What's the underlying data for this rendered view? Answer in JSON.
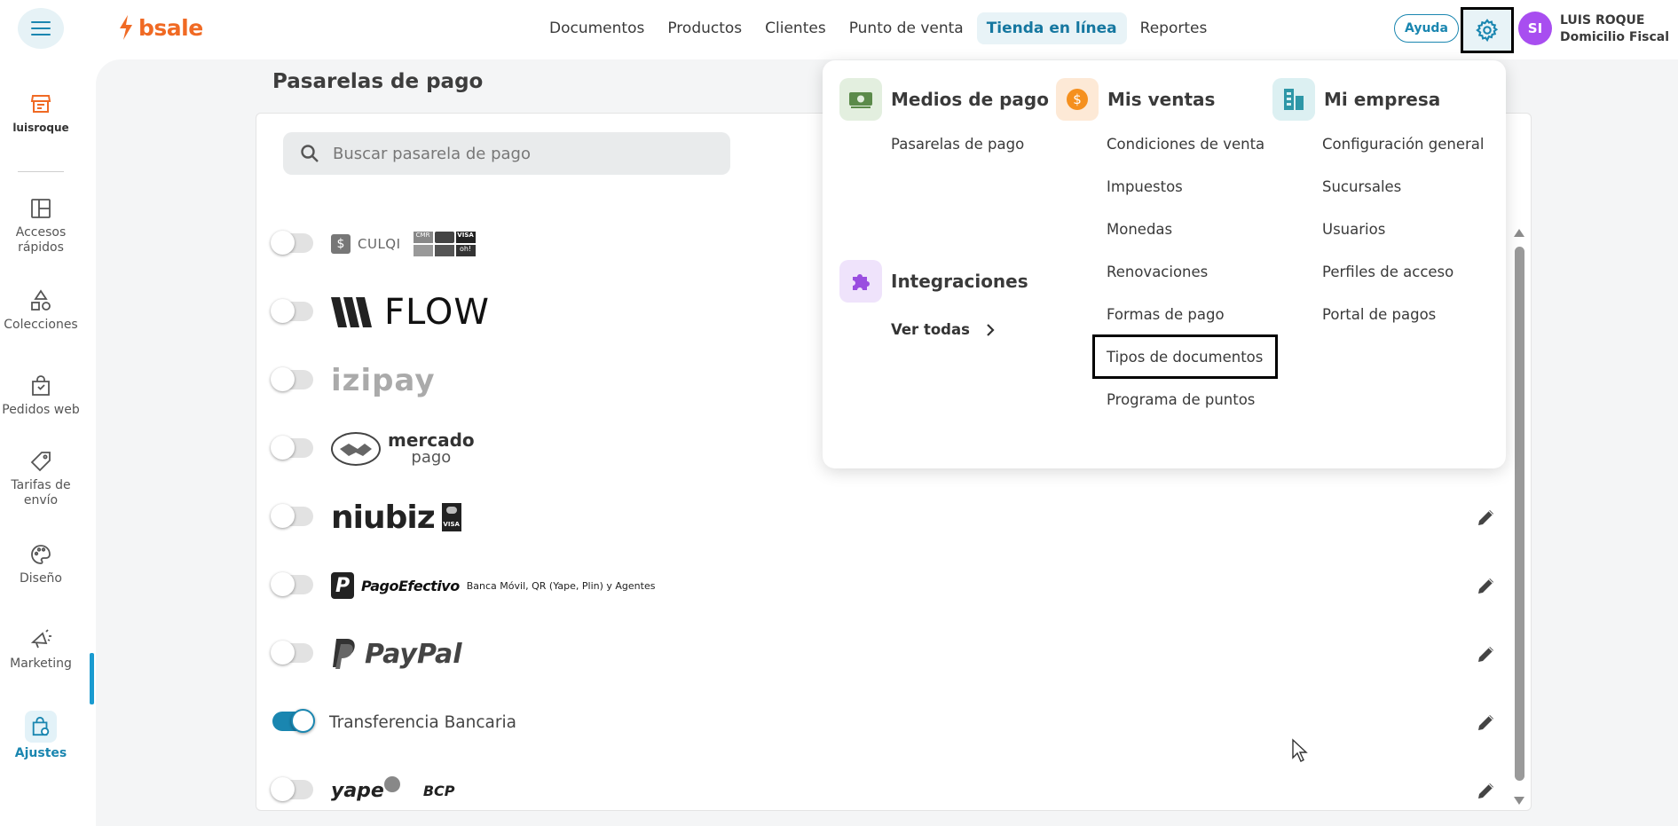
{
  "brand": {
    "name": "bsale",
    "color": "#f06a24"
  },
  "accent": "#1a86b0",
  "nav": {
    "items": [
      {
        "label": "Documentos",
        "active": false
      },
      {
        "label": "Productos",
        "active": false
      },
      {
        "label": "Clientes",
        "active": false
      },
      {
        "label": "Punto de venta",
        "active": false
      },
      {
        "label": "Tienda en línea",
        "active": true
      },
      {
        "label": "Reportes",
        "active": false
      }
    ]
  },
  "header": {
    "help_label": "Ayuda",
    "avatar_initials": "SI",
    "user_name": "LUIS ROQUE",
    "user_branch": "Domicilio Fiscal"
  },
  "sidebar": {
    "store_name": "luisroque",
    "items": [
      {
        "label_line1": "Accesos",
        "label_line2": "rápidos",
        "icon": "layout-icon"
      },
      {
        "label_line1": "Colecciones",
        "label_line2": "",
        "icon": "shapes-icon"
      },
      {
        "label_line1": "Pedidos web",
        "label_line2": "",
        "icon": "shopping-bag-icon"
      },
      {
        "label_line1": "Tarifas de",
        "label_line2": "envío",
        "icon": "tag-icon"
      },
      {
        "label_line1": "Diseño",
        "label_line2": "",
        "icon": "palette-icon"
      },
      {
        "label_line1": "Marketing",
        "label_line2": "",
        "icon": "megaphone-icon"
      },
      {
        "label_line1": "Ajustes",
        "label_line2": "",
        "icon": "settings-bag-icon",
        "active": true
      }
    ]
  },
  "page": {
    "title": "Pasarelas de pago",
    "search_placeholder": "Buscar pasarela de pago"
  },
  "gateways": [
    {
      "name": "CULQI",
      "enabled": false,
      "editable": false
    },
    {
      "name": "FLOW",
      "enabled": false,
      "editable": false
    },
    {
      "name": "izipay",
      "enabled": false,
      "editable": false
    },
    {
      "name": "mercado pago",
      "name_line1": "mercado",
      "name_line2": "pago",
      "enabled": false,
      "editable": false
    },
    {
      "name": "niubiz",
      "enabled": false,
      "editable": true
    },
    {
      "name": "PagoEfectivo",
      "subtitle": "Banca Móvil, QR (Yape, Plin) y Agentes",
      "enabled": false,
      "editable": true
    },
    {
      "name": "PayPal",
      "enabled": false,
      "editable": true
    },
    {
      "name": "Transferencia Bancaria",
      "enabled": true,
      "editable": true
    },
    {
      "name": "yape",
      "name2": "BCP",
      "enabled": false,
      "editable": true
    }
  ],
  "card_labels": {
    "culqi_row1": [
      "CMR",
      "",
      "VISA"
    ],
    "culqi_row2": [
      "",
      "",
      "oh!"
    ],
    "niubiz_card": "VISA"
  },
  "menu": {
    "medios": {
      "title": "Medios de pago",
      "links": [
        "Pasarelas de pago"
      ]
    },
    "ventas": {
      "title": "Mis ventas",
      "links": [
        "Condiciones de venta",
        "Impuestos",
        "Monedas",
        "Renovaciones",
        "Formas de pago",
        "Tipos de documentos",
        "Programa de puntos"
      ]
    },
    "empresa": {
      "title": "Mi empresa",
      "links": [
        "Configuración general",
        "Sucursales",
        "Usuarios",
        "Perfiles de acceso",
        "Portal de pagos"
      ]
    },
    "integraciones": {
      "title": "Integraciones",
      "link": "Ver todas"
    }
  }
}
